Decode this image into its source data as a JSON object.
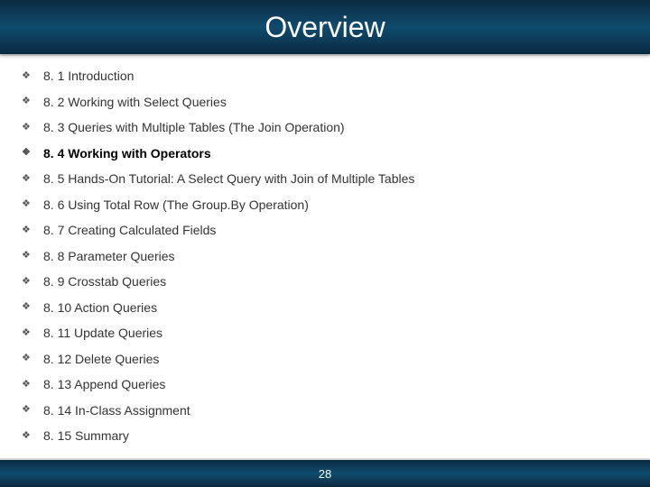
{
  "title": "Overview",
  "page_number": "28",
  "items": [
    {
      "text": "8. 1 Introduction",
      "bold": false
    },
    {
      "text": "8. 2 Working with Select Queries",
      "bold": false
    },
    {
      "text": "8. 3 Queries with Multiple Tables (The Join Operation)",
      "bold": false
    },
    {
      "text": "8. 4 Working with Operators",
      "bold": true
    },
    {
      "text": "8. 5 Hands-On Tutorial: A Select Query with Join of Multiple Tables",
      "bold": false
    },
    {
      "text": "8. 6 Using Total Row (The Group.By Operation)",
      "bold": false
    },
    {
      "text": "8. 7 Creating Calculated Fields",
      "bold": false
    },
    {
      "text": "8. 8 Parameter Queries",
      "bold": false
    },
    {
      "text": "8. 9 Crosstab Queries",
      "bold": false
    },
    {
      "text": "8. 10 Action Queries",
      "bold": false
    },
    {
      "text": "8. 11 Update Queries",
      "bold": false
    },
    {
      "text": "8. 12 Delete Queries",
      "bold": false
    },
    {
      "text": "8. 13 Append Queries",
      "bold": false
    },
    {
      "text": "8. 14 In-Class Assignment",
      "bold": false
    },
    {
      "text": "8. 15 Summary",
      "bold": false
    }
  ]
}
